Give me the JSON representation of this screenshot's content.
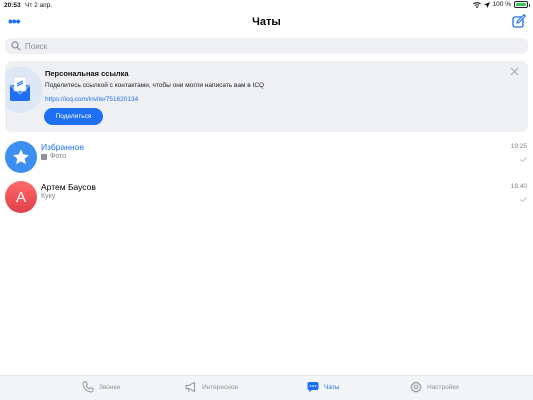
{
  "status": {
    "time": "20:53",
    "date": "Чт 2 апр.",
    "battery": "100 %"
  },
  "header": {
    "title": "Чаты",
    "menu_label": "•••"
  },
  "search": {
    "placeholder": "Поиск"
  },
  "banner": {
    "title": "Персональная ссылка",
    "description": "Поделитесь ссылкой с контактами, чтобы они могли написать вам в ICQ",
    "link": "https://icq.com/invite/751620134",
    "share_label": "Поделиться"
  },
  "chats": [
    {
      "name": "Избранное",
      "preview": "Фото",
      "time": "19:25",
      "avatar_icon": "star-icon",
      "color": "#3d8ff2"
    },
    {
      "name": "Артем Баусов",
      "preview": "Куку",
      "time": "18:40",
      "avatar_letter": "А",
      "color": "#e03f4a"
    }
  ],
  "tabs": [
    {
      "label": "Звонки",
      "icon": "phone-icon",
      "active": false
    },
    {
      "label": "Интересное",
      "icon": "megaphone-icon",
      "active": false
    },
    {
      "label": "Чаты",
      "icon": "chat-bubble-icon",
      "active": true
    },
    {
      "label": "Настройки",
      "icon": "gear-icon",
      "active": false
    }
  ],
  "colors": {
    "accent": "#1e6ff2",
    "panel": "#eef0f3"
  }
}
